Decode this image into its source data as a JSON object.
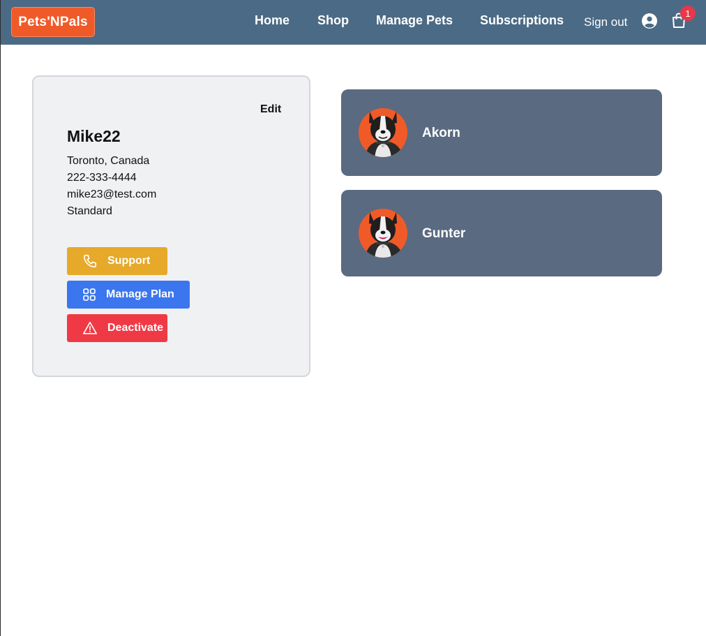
{
  "brand": {
    "logo_text": "Pets'NPals",
    "logo_color": "#f05a28"
  },
  "nav": {
    "links": [
      "Home",
      "Shop",
      "Manage Pets",
      "Subscriptions"
    ],
    "sign_out": "Sign out",
    "cart_count": "1",
    "account_icon": "account-circle-icon",
    "cart_icon": "shopping-bag-icon",
    "background": "#4b6a85"
  },
  "profile": {
    "edit_label": "Edit",
    "username": "Mike22",
    "location": "Toronto, Canada",
    "phone": "222-333-4444",
    "email": "mike23@test.com",
    "plan": "Standard"
  },
  "actions": [
    {
      "label": "Support",
      "icon": "phone-icon",
      "color": "#e6a92a"
    },
    {
      "label": "Manage Plan",
      "icon": "grid-icon",
      "color": "#3b76ef"
    },
    {
      "label": "Deactivate",
      "icon": "warning-icon",
      "color": "#ef3a46"
    }
  ],
  "pets": [
    {
      "name": "Akorn",
      "avatar": "dog-avatar"
    },
    {
      "name": "Gunter",
      "avatar": "dog-avatar"
    }
  ],
  "colors": {
    "pet_card": "#5a6a80",
    "profile_bg": "#f0f1f3",
    "avatar_bg": "#f05a28"
  }
}
